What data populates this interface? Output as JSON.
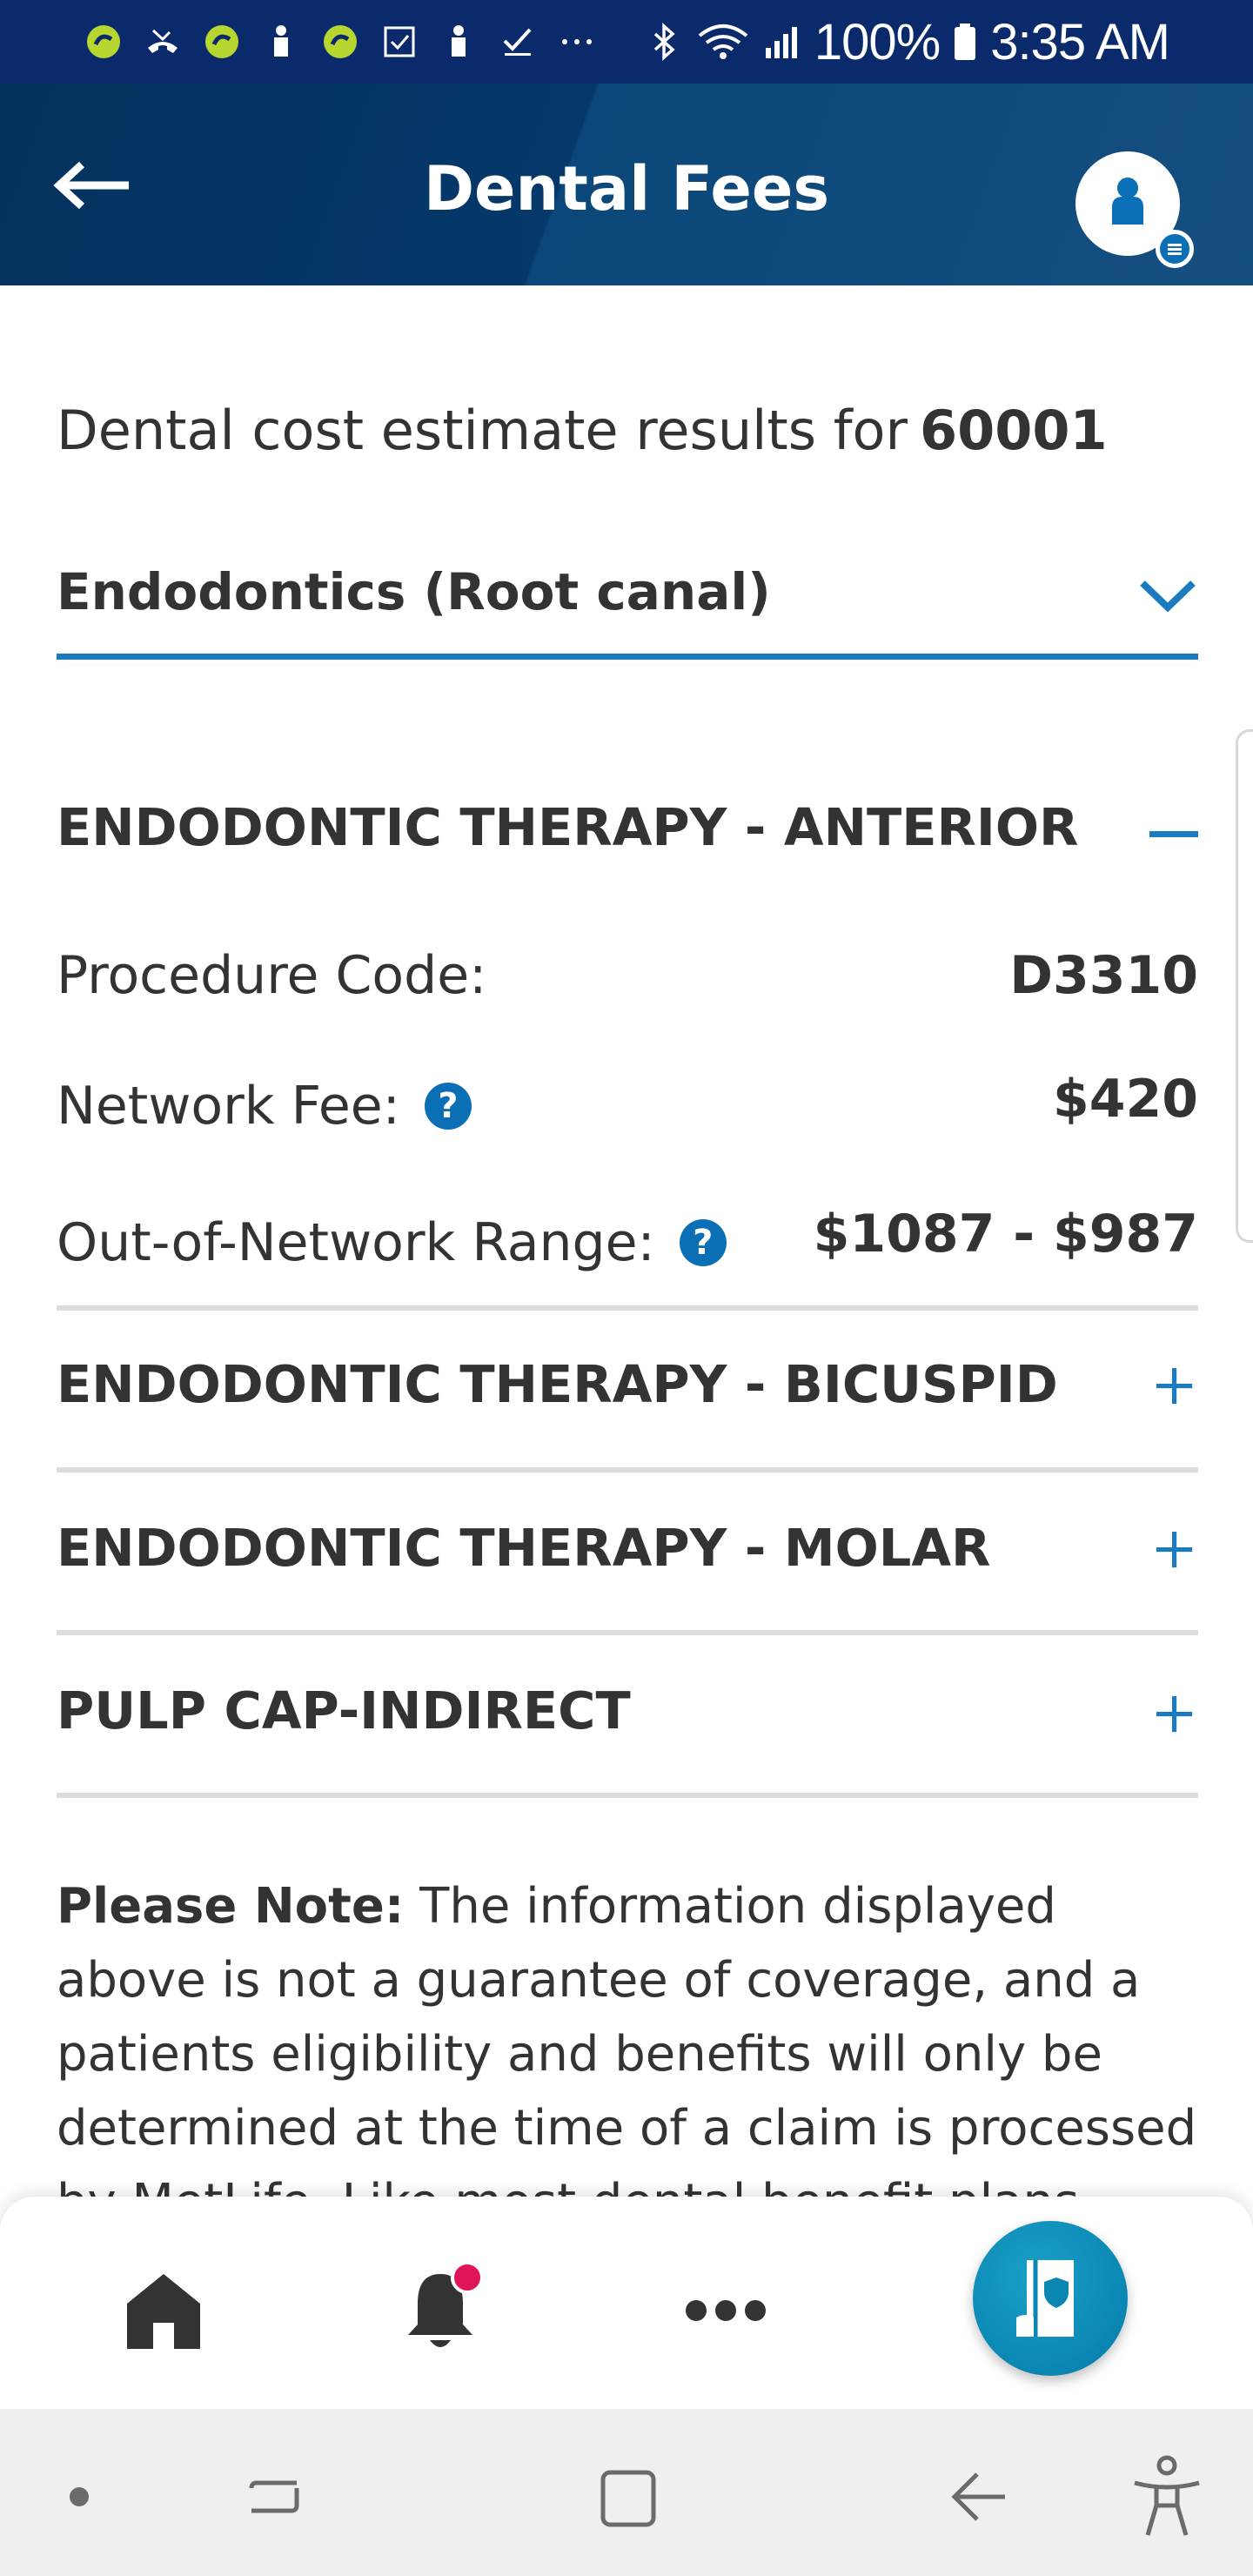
{
  "status_bar": {
    "battery_percent": "100%",
    "time": "3:35 AM",
    "left_icons": [
      "app-notification-icon",
      "missed-call-icon",
      "app-notification-icon",
      "person-icon",
      "app-notification-icon",
      "checkbox-icon",
      "person-icon",
      "check-icon",
      "more-icon"
    ],
    "right_icons": [
      "bluetooth-icon",
      "wifi-icon",
      "signal-icon",
      "battery-icon"
    ]
  },
  "header": {
    "title": "Dental Fees"
  },
  "main": {
    "result_prefix": "Dental cost estimate results for",
    "zip_code": "60001",
    "category": "Endodontics (Root canal)",
    "sections": [
      {
        "title": "ENDODONTIC THERAPY - ANTERIOR",
        "expanded": true,
        "procedure_code_label": "Procedure Code:",
        "procedure_code": "D3310",
        "network_fee_label": "Network Fee:",
        "network_fee": "$420",
        "out_of_network_label": "Out-of-Network Range:",
        "out_of_network_range": "$1087 - $987"
      },
      {
        "title": "ENDODONTIC THERAPY - BICUSPID",
        "expanded": false
      },
      {
        "title": "ENDODONTIC THERAPY - MOLAR",
        "expanded": false
      },
      {
        "title": "PULP CAP-INDIRECT",
        "expanded": false
      }
    ],
    "note_label": "Please Note:",
    "note_text": "The information displayed above is not a guarantee of coverage, and a patients eligibility and benefits will only be determined at the time of a claim is processed by MetLife. Like most dental benefit plans, MetLife's dental plans"
  },
  "bottom_nav": {
    "items": [
      "home-icon",
      "bell-icon",
      "more-icon"
    ],
    "fab": "id-card-icon",
    "has_notification": true
  },
  "colors": {
    "header_bg": "#04325e",
    "status_bg": "#0b2a6b",
    "accent_blue": "#1b7bc1",
    "notification": "#e01458",
    "fab": "#0a86b3"
  }
}
